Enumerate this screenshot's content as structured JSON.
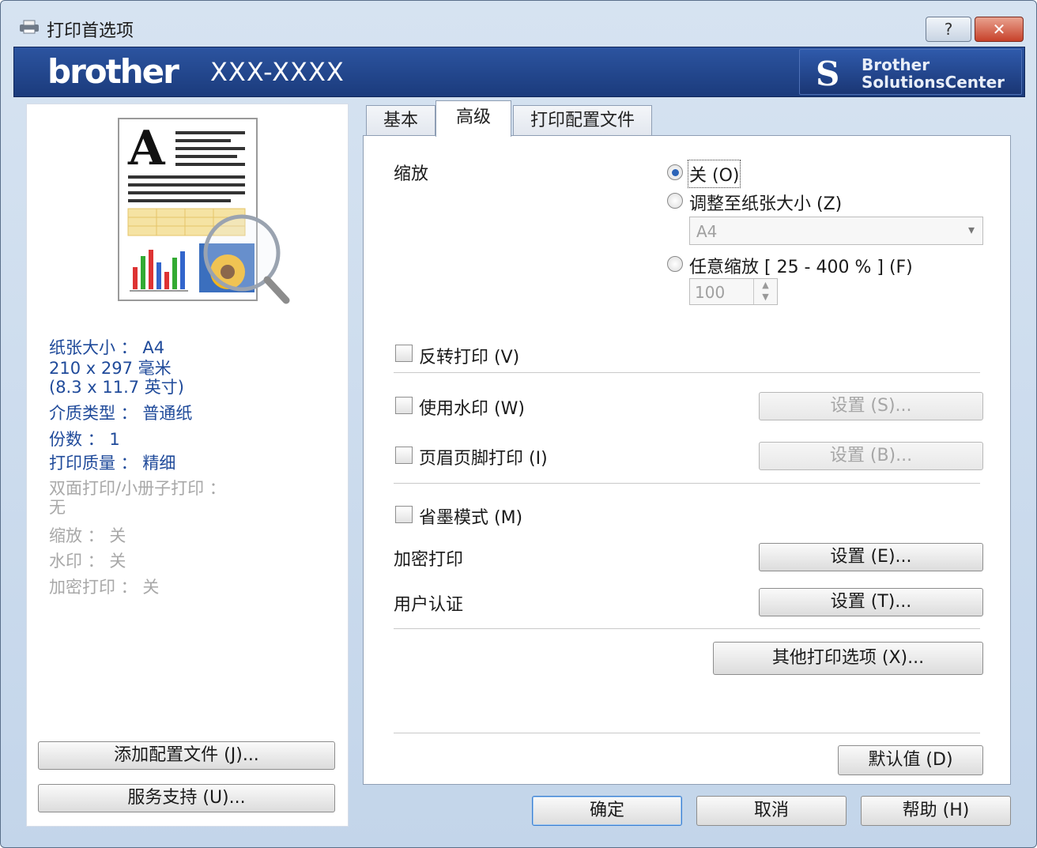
{
  "window": {
    "title": "打印首选项",
    "help_glyph": "?",
    "close_glyph": "✕"
  },
  "banner": {
    "brand": "brother",
    "model": "XXX-XXXX",
    "solutions_line1": "Brother",
    "solutions_line2": "SolutionsCenter"
  },
  "summary": {
    "paper_size": "纸张大小 ： A4",
    "paper_dims_mm": "210 x 297 毫米",
    "paper_dims_in": "(8.3 x 11.7 英寸)",
    "media_type": "介质类型 ： 普通纸",
    "copies": "份数 ： 1",
    "print_quality": "打印质量 ： 精细",
    "duplex_label": "双面打印/小册子打印 ：",
    "duplex_value": "无",
    "scaling": "缩放 ： 关",
    "watermark": "水印 ： 关",
    "secure_print": "加密打印 ： 关"
  },
  "left_buttons": {
    "add_profile": "添加配置文件 (J)...",
    "support": "服务支持 (U)..."
  },
  "tabs": [
    "基本",
    "高级",
    "打印配置文件"
  ],
  "advanced": {
    "scaling_label": "缩放",
    "scale_off": "关 (O)",
    "scale_fit": "调整至纸张大小 (Z)",
    "fit_paper_value": "A4",
    "scale_free": "任意缩放 [ 25 - 400 % ] (F)",
    "free_value": "100",
    "reverse_print": "反转打印 (V)",
    "use_watermark": "使用水印 (W)",
    "watermark_settings": "设置 (S)...",
    "header_footer": "页眉页脚打印 (I)",
    "header_settings": "设置 (B)...",
    "toner_save": "省墨模式 (M)",
    "secure_print_label": "加密打印",
    "secure_settings": "设置 (E)...",
    "user_auth_label": "用户认证",
    "auth_settings": "设置 (T)...",
    "other_options": "其他打印选项 (X)...",
    "defaults": "默认值 (D)"
  },
  "footer": {
    "ok": "确定",
    "cancel": "取消",
    "help": "帮助 (H)"
  },
  "colors": {
    "banner": "#1b3b7c",
    "info_text": "#1f4a9a",
    "radio_selected": "#2b63b7",
    "close_button": "#c7412a"
  }
}
